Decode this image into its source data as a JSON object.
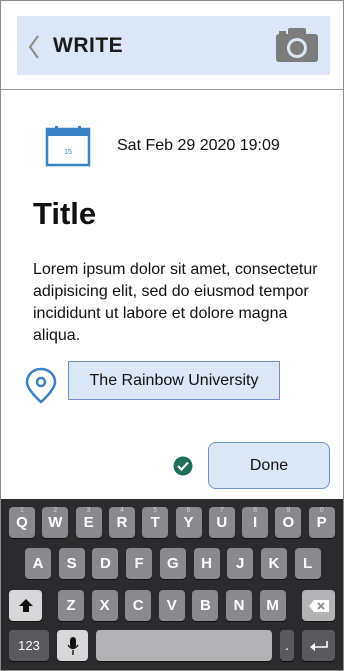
{
  "header": {
    "title": "WRITE",
    "back_icon": "chevron-left-icon",
    "camera_icon": "camera-icon"
  },
  "entry": {
    "calendar_icon": "calendar-icon",
    "calendar_day": "15",
    "datetime": "Sat Feb 29 2020 19:09",
    "title": "Title",
    "body": "Lorem ipsum dolor sit amet, consectetur adipisicing elit, sed do eiusmod tempor incididunt ut labore et dolore magna aliqua."
  },
  "location": {
    "icon": "map-pin-icon",
    "value": "The Rainbow University"
  },
  "actions": {
    "check_icon": "check-circle-icon",
    "done_label": "Done"
  },
  "keyboard": {
    "row1": [
      {
        "k": "Q",
        "h": "1"
      },
      {
        "k": "W",
        "h": "2"
      },
      {
        "k": "E",
        "h": "3"
      },
      {
        "k": "R",
        "h": "4"
      },
      {
        "k": "T",
        "h": "5"
      },
      {
        "k": "Y",
        "h": "6"
      },
      {
        "k": "U",
        "h": "7"
      },
      {
        "k": "I",
        "h": "8"
      },
      {
        "k": "O",
        "h": "9"
      },
      {
        "k": "P",
        "h": "0"
      }
    ],
    "row2": [
      "A",
      "S",
      "D",
      "F",
      "G",
      "H",
      "J",
      "K",
      "L"
    ],
    "row3": [
      "Z",
      "X",
      "C",
      "V",
      "B",
      "N",
      "M"
    ],
    "numbers_label": "123",
    "period_label": ".",
    "shift_icon": "shift-icon",
    "backspace_icon": "backspace-icon",
    "mic_icon": "microphone-icon",
    "return_icon": "return-icon"
  },
  "colors": {
    "accent_fill": "#dbe7f7",
    "accent_border": "#6f93c8",
    "icon_blue": "#3b82c4",
    "check_green": "#1f6e5c",
    "keyboard_bg": "#2b2b2d"
  }
}
